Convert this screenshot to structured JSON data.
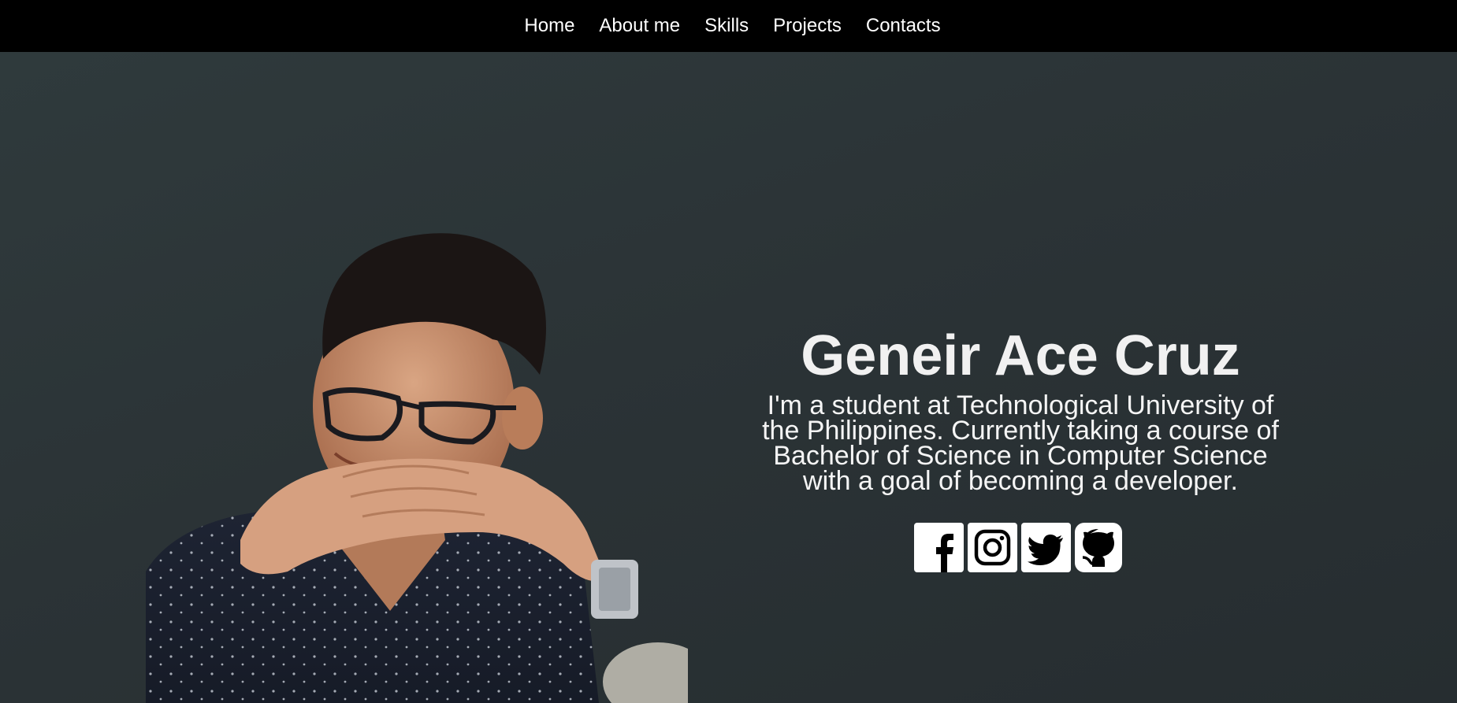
{
  "nav": {
    "items": [
      "Home",
      "About me",
      "Skills",
      "Projects",
      "Contacts"
    ]
  },
  "hero": {
    "name": "Geneir Ace Cruz",
    "bio_lines": [
      "I'm a student at Technological University of",
      "the Philippines. Currently taking a course of",
      "Bachelor of Science in Computer Science",
      "with a goal of becoming a developer."
    ],
    "photo_alt": "Portrait photo"
  },
  "socials": {
    "icons": [
      "facebook-icon",
      "instagram-icon",
      "twitter-icon",
      "github-icon"
    ]
  },
  "colors": {
    "nav_bg": "#000000",
    "hero_bg": "#2b3336",
    "text": "#f2f2f2",
    "icon_bg": "#ffffff"
  }
}
